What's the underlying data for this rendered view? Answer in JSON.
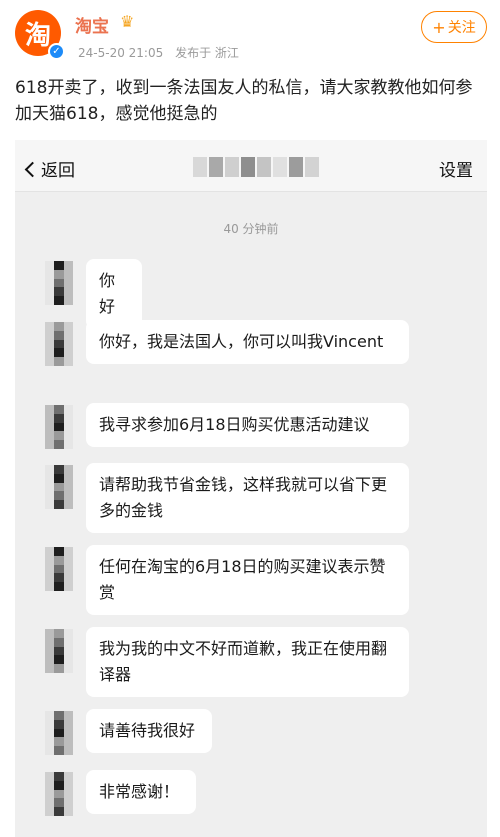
{
  "post": {
    "author": "淘宝",
    "avatar_text": "淘",
    "crown_icon": "crown-icon",
    "date": "24-5-20 21:05",
    "source": "发布于 浙江",
    "follow_label": "关注",
    "text": "618开卖了，收到一条法国友人的私信，请大家教教他如何参加天猫618，感觉他挺急的"
  },
  "chat": {
    "back_label": "返回",
    "settings_label": "设置",
    "timestamp": "40 分钟前",
    "messages": [
      {
        "text": "你好"
      },
      {
        "text": "你好，我是法国人，你可以叫我Vincent"
      },
      {
        "text": "我寻求参加6月18日购买优惠活动建议"
      },
      {
        "text": "请帮助我节省金钱，这样我就可以省下更多的金钱"
      },
      {
        "text": "任何在淘宝的6月18日的购买建议表示赞赏"
      },
      {
        "text": "我为我的中文不好而道歉，我正在使用翻译器"
      },
      {
        "text": "请善待我很好"
      },
      {
        "text": "非常感谢！"
      }
    ]
  },
  "colors": {
    "brand_orange": "#ff5a00",
    "author_name": "#eb7350",
    "follow_orange": "#ff8200",
    "verified_blue": "#1d8bf8",
    "chat_background": "#efefef"
  }
}
